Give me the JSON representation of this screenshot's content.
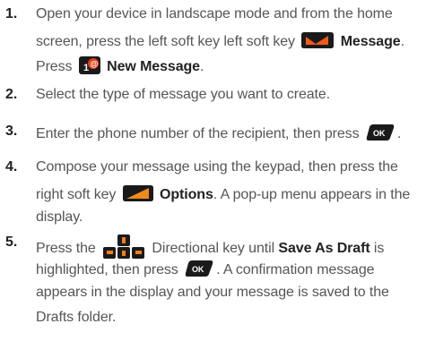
{
  "steps": [
    {
      "num": "1.",
      "l1": "Open your device in landscape mode and from the home",
      "l2a": "screen, press the left soft key left soft key",
      "l2b": "Message",
      "l2c": ".",
      "l3a": "Press",
      "l3b": "New Message",
      "l3c": "."
    },
    {
      "num": "2.",
      "l1": "Select the type of message you want to create."
    },
    {
      "num": "3.",
      "l1": "Enter the phone number of the recipient, then press",
      "l1c": "."
    },
    {
      "num": "4.",
      "l1": "Compose your message using the keypad, then press the",
      "l2a": "right soft key",
      "l2b": "Options",
      "l2c": ". A pop-up menu appears in the",
      "l3": "display."
    },
    {
      "num": "5.",
      "l1a": "Press the",
      "l1b": "Directional key until",
      "l1c": "Save As Draft",
      "l1d": "is",
      "l2a": "highlighted, then press",
      "l2b": ". A confirmation message",
      "l3": "appears in the display and your message is saved to the",
      "l4": "Drafts folder."
    }
  ],
  "icon_colors": {
    "softkey_black": "#1a1a1a",
    "message_accent": "#f05a1a",
    "newmsg_red": "#e8401c",
    "ok_grey": "#7a7a7a",
    "options_orange": "#f08a1a",
    "dpad_orange": "#ef7f1a"
  }
}
